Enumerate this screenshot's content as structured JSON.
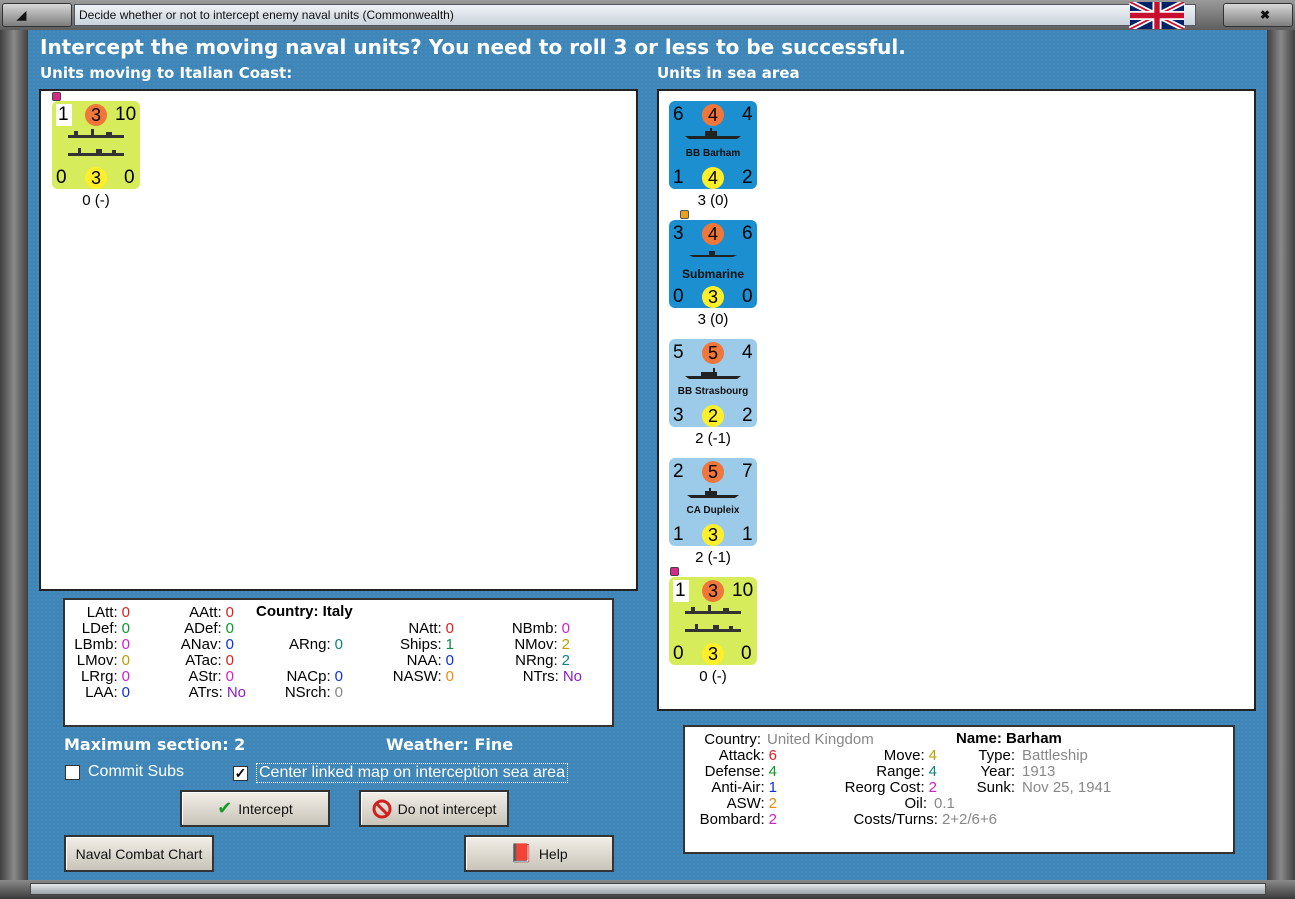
{
  "window": {
    "title": "Decide whether or not to intercept enemy naval units (Commonwealth)"
  },
  "headline": "Intercept the moving naval units?  You need to roll 3 or less to be successful.",
  "left_section": {
    "label": "Units moving to Italian Coast:",
    "units": [
      {
        "tl": "1",
        "tc": "3",
        "tr": "10",
        "bl": "0",
        "bc": "3",
        "br": "0",
        "caption": "0 (-)",
        "style": "green"
      }
    ]
  },
  "right_section": {
    "label": "Units in sea area",
    "units": [
      {
        "tl": "6",
        "tc": "4",
        "tr": "4",
        "name": "BB Barham",
        "bl": "1",
        "bc": "4",
        "br": "2",
        "caption": "3 (0)",
        "style": "dark"
      },
      {
        "tl": "3",
        "tc": "4",
        "tr": "6",
        "name": "Submarine",
        "bl": "0",
        "bc": "3",
        "br": "0",
        "caption": "3 (0)",
        "style": "dark"
      },
      {
        "tl": "5",
        "tc": "5",
        "tr": "4",
        "name": "BB Strasbourg",
        "bl": "3",
        "bc": "2",
        "br": "2",
        "caption": "2 (-1)",
        "style": "light"
      },
      {
        "tl": "2",
        "tc": "5",
        "tr": "7",
        "name": "CA Dupleix",
        "bl": "1",
        "bc": "3",
        "br": "1",
        "caption": "2 (-1)",
        "style": "light"
      },
      {
        "tl": "1",
        "tc": "3",
        "tr": "10",
        "bl": "0",
        "bc": "3",
        "br": "0",
        "caption": "0 (-)",
        "style": "green"
      }
    ]
  },
  "left_stats": {
    "latt": {
      "label": "LAtt:",
      "value": "0"
    },
    "ldef": {
      "label": "LDef:",
      "value": "0"
    },
    "lbmb": {
      "label": "LBmb:",
      "value": "0"
    },
    "lmov": {
      "label": "LMov:",
      "value": "0"
    },
    "lrrg": {
      "label": "LRrg:",
      "value": "0"
    },
    "laa": {
      "label": "LAA:",
      "value": "0"
    },
    "aatt": {
      "label": "AAtt:",
      "value": "0"
    },
    "adef": {
      "label": "ADef:",
      "value": "0"
    },
    "anav": {
      "label": "ANav:",
      "value": "0"
    },
    "atac": {
      "label": "ATac:",
      "value": "0"
    },
    "astr": {
      "label": "AStr:",
      "value": "0"
    },
    "atrs": {
      "label": "ATrs:",
      "value": "No"
    },
    "country": "Country: Italy",
    "arng": {
      "label": "ARng:",
      "value": "0"
    },
    "nacp": {
      "label": "NACp:",
      "value": "0"
    },
    "nsrch": {
      "label": "NSrch:",
      "value": "0"
    },
    "natt": {
      "label": "NAtt:",
      "value": "0"
    },
    "ships": {
      "label": "Ships:",
      "value": "1"
    },
    "naa": {
      "label": "NAA:",
      "value": "0"
    },
    "nasw": {
      "label": "NASW:",
      "value": "0"
    },
    "nbmb": {
      "label": "NBmb:",
      "value": "0"
    },
    "nmov": {
      "label": "NMov:",
      "value": "2"
    },
    "nrng": {
      "label": "NRng:",
      "value": "2"
    },
    "ntrs": {
      "label": "NTrs:",
      "value": "No"
    }
  },
  "right_stats": {
    "country": {
      "label": "Country:",
      "value": "United Kingdom"
    },
    "attack": {
      "label": "Attack:",
      "value": "6"
    },
    "defense": {
      "label": "Defense:",
      "value": "4"
    },
    "antiair": {
      "label": "Anti-Air:",
      "value": "1"
    },
    "asw": {
      "label": "ASW:",
      "value": "2"
    },
    "bombard": {
      "label": "Bombard:",
      "value": "2"
    },
    "move": {
      "label": "Move:",
      "value": "4"
    },
    "range": {
      "label": "Range:",
      "value": "4"
    },
    "reorg": {
      "label": "Reorg Cost:",
      "value": "2"
    },
    "oil": {
      "label": "Oil:",
      "value": "0.1"
    },
    "costs": {
      "label": "Costs/Turns:",
      "value": "2+2/6+6"
    },
    "name": "Name: Barham",
    "type": {
      "label": "Type:",
      "value": "Battleship"
    },
    "year": {
      "label": "Year:",
      "value": "1913"
    },
    "sunk": {
      "label": "Sunk:",
      "value": "Nov 25, 1941"
    }
  },
  "info": {
    "max_section": "Maximum section: 2",
    "weather": "Weather:  Fine"
  },
  "checkboxes": {
    "commit_subs": {
      "label": "Commit Subs",
      "checked": false
    },
    "center_map": {
      "label": "Center linked map on interception sea area",
      "checked": true
    }
  },
  "buttons": {
    "intercept": "Intercept",
    "do_not_intercept": "Do not intercept",
    "naval_combat_chart": "Naval Combat Chart",
    "help": "Help"
  },
  "colors": {
    "panel_blue": "#3e86b8",
    "unit_dark": "#1c8fd0",
    "unit_light": "#9ccbe9",
    "unit_green": "#d6ec5a",
    "attack_circle": "#f0763a",
    "defense_circle": "#ffef2a"
  }
}
